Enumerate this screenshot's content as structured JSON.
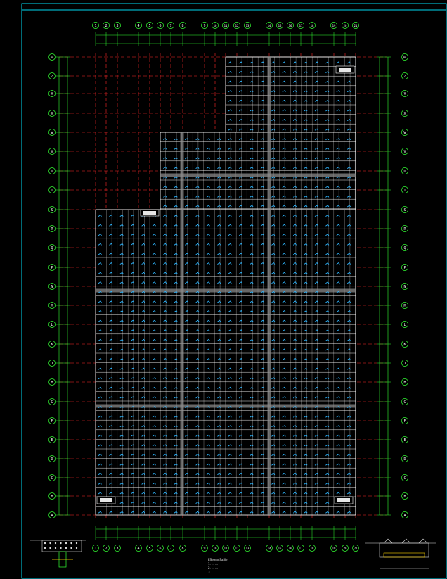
{
  "drawing": {
    "colors": {
      "background": "#000000",
      "frame": "#00d8f0",
      "axis": "#33ff33",
      "grid": "#ff2a2a",
      "structure": "#ffffff",
      "symbol": "#2fb6ff",
      "band": "#8a8a8a",
      "yellow": "#ffd400"
    },
    "column_axes": [
      "1",
      "2",
      "3",
      "4",
      "5",
      "6",
      "7",
      "8",
      "9",
      "10",
      "11",
      "12",
      "13",
      "14",
      "15",
      "16",
      "17",
      "18",
      "19",
      "20",
      "21"
    ],
    "row_axes": [
      "A",
      "B",
      "C",
      "D",
      "E",
      "F",
      "G",
      "H",
      "J",
      "K",
      "L",
      "M",
      "N",
      "P",
      "Q",
      "R",
      "S",
      "T",
      "U",
      "V",
      "W",
      "X",
      "Y",
      "Z",
      "AA"
    ]
  },
  "notes": {
    "title": "ESemadSaSle",
    "lines": [
      "1. ... ...",
      "2. ... ...",
      "3. ... ..."
    ]
  }
}
